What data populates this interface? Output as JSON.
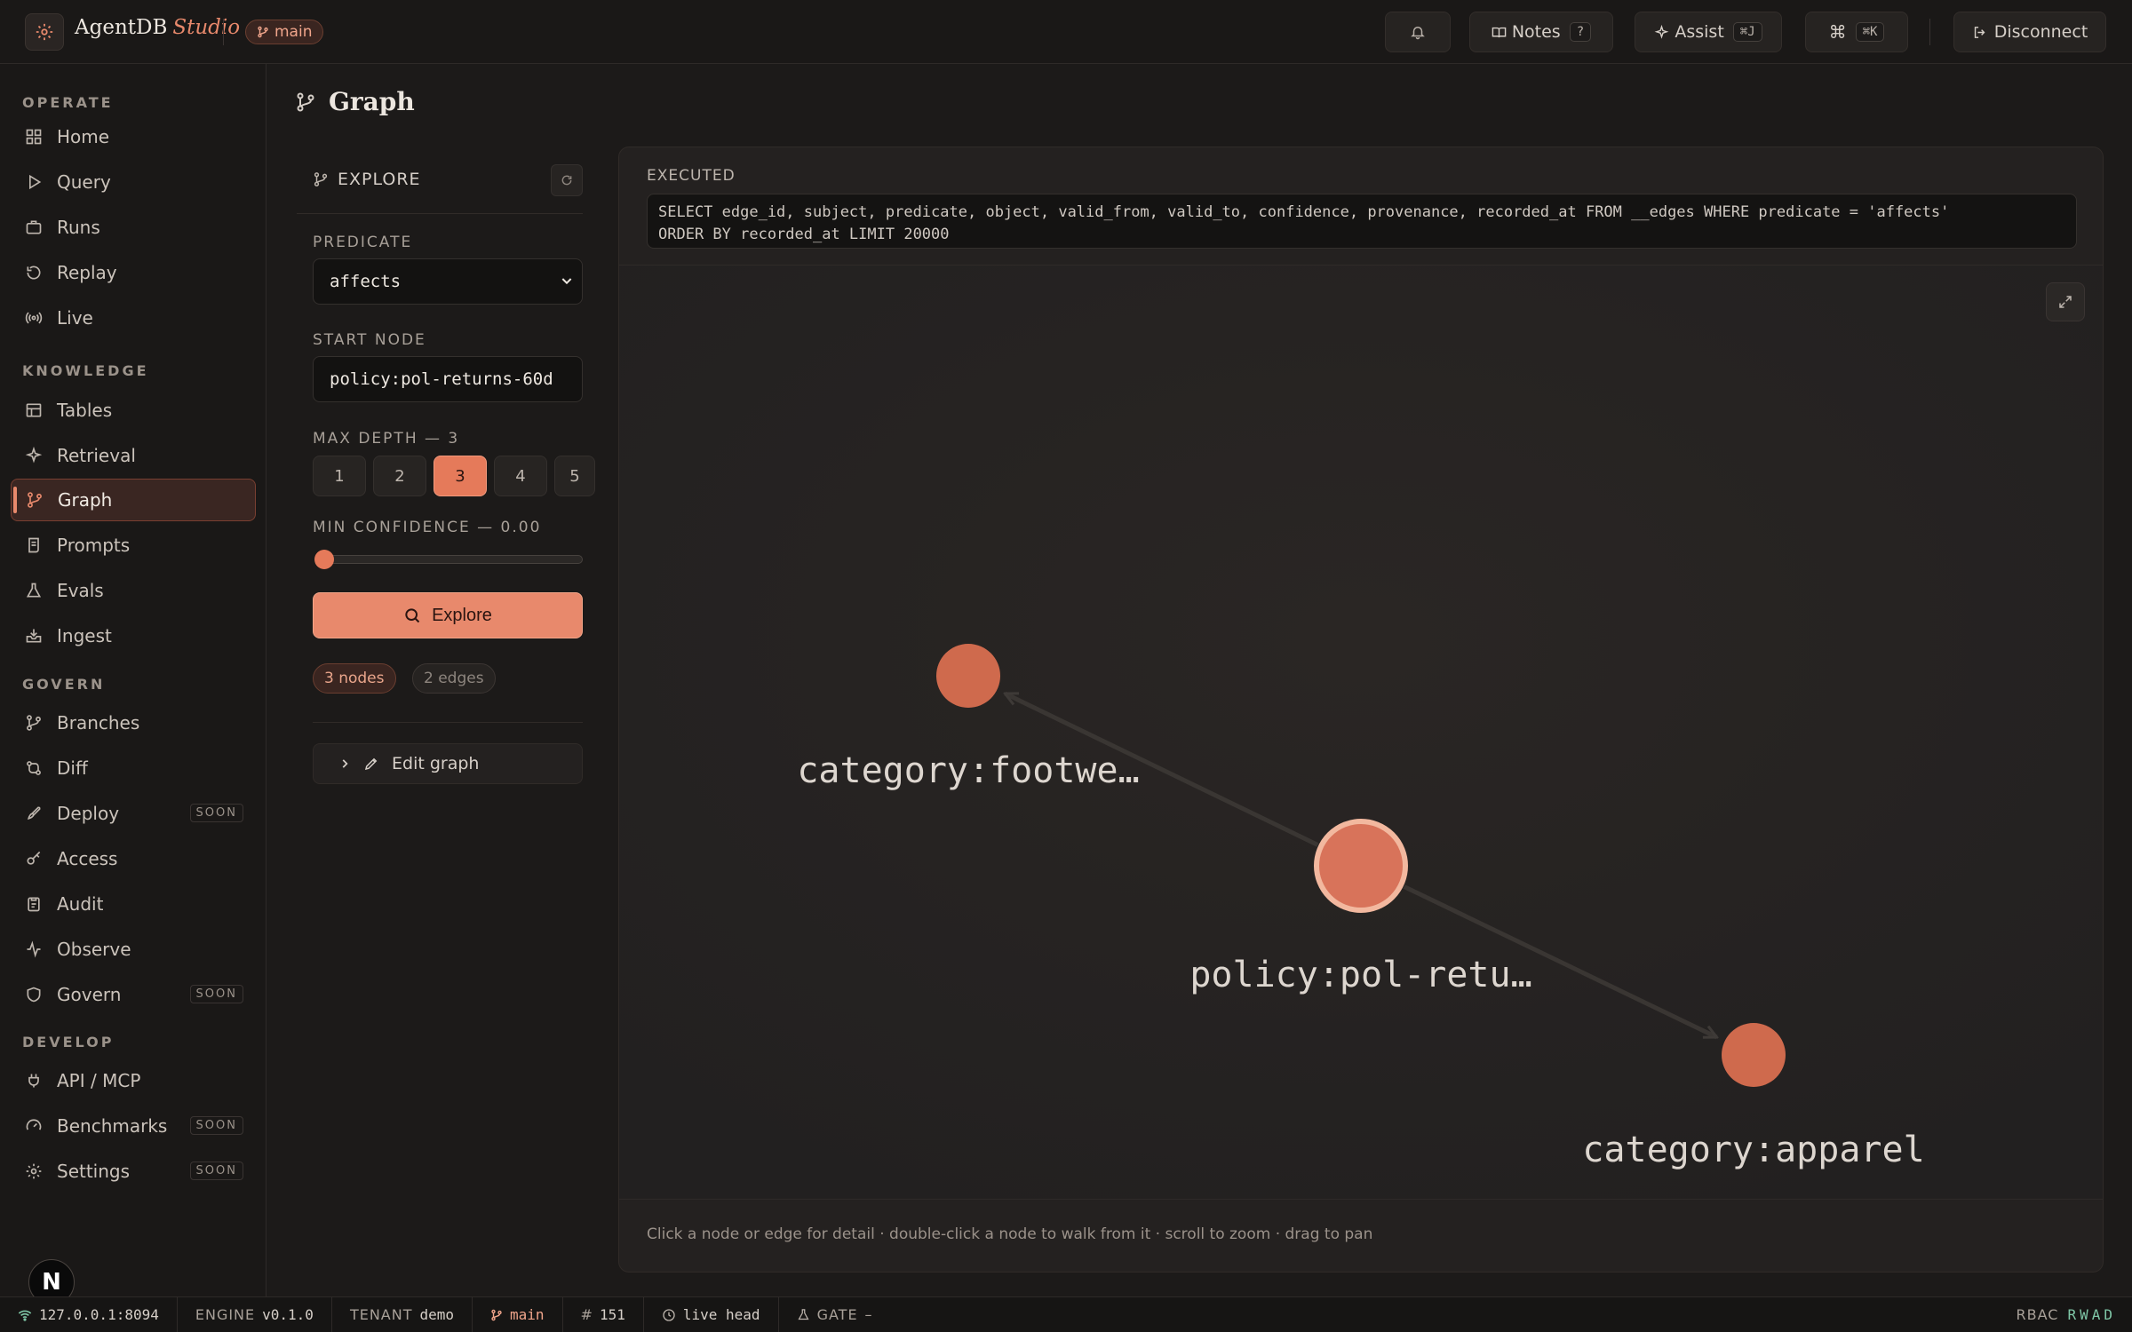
{
  "app": {
    "name": "AgentDB",
    "name_suffix": "Studio",
    "branch": "main"
  },
  "toolbar": {
    "notes_label": "Notes",
    "notes_kbd": "?",
    "assist_label": "Assist",
    "assist_kbd": "⌘J",
    "command_glyph": "⌘",
    "command_kbd": "⌘K",
    "disconnect_label": "Disconnect"
  },
  "sidebar": {
    "sections": [
      {
        "title": "OPERATE",
        "items": [
          {
            "label": "Home",
            "icon": "grid-icon"
          },
          {
            "label": "Query",
            "icon": "play-icon"
          },
          {
            "label": "Runs",
            "icon": "briefcase-icon"
          },
          {
            "label": "Replay",
            "icon": "rotate-icon"
          },
          {
            "label": "Live",
            "icon": "broadcast-icon"
          }
        ]
      },
      {
        "title": "KNOWLEDGE",
        "items": [
          {
            "label": "Tables",
            "icon": "table-icon"
          },
          {
            "label": "Retrieval",
            "icon": "sparkle-icon"
          },
          {
            "label": "Graph",
            "icon": "graph-icon",
            "active": true
          },
          {
            "label": "Prompts",
            "icon": "scroll-icon"
          },
          {
            "label": "Evals",
            "icon": "flask-icon"
          },
          {
            "label": "Ingest",
            "icon": "inbox-icon"
          }
        ]
      },
      {
        "title": "GOVERN",
        "items": [
          {
            "label": "Branches",
            "icon": "git-branch-icon"
          },
          {
            "label": "Diff",
            "icon": "git-compare-icon"
          },
          {
            "label": "Deploy",
            "icon": "rocket-icon",
            "badge": "SOON"
          },
          {
            "label": "Access",
            "icon": "key-icon"
          },
          {
            "label": "Audit",
            "icon": "clipboard-icon"
          },
          {
            "label": "Observe",
            "icon": "activity-icon"
          },
          {
            "label": "Govern",
            "icon": "shield-icon",
            "badge": "SOON"
          }
        ]
      },
      {
        "title": "DEVELOP",
        "items": [
          {
            "label": "API / MCP",
            "icon": "plug-icon"
          },
          {
            "label": "Benchmarks",
            "icon": "gauge-icon",
            "badge": "SOON"
          },
          {
            "label": "Settings",
            "icon": "gear-icon",
            "badge": "SOON"
          }
        ]
      }
    ],
    "avatar_letter": "N"
  },
  "page": {
    "title": "Graph"
  },
  "explore": {
    "title": "EXPLORE",
    "predicate_label": "PREDICATE",
    "predicate_value": "affects",
    "start_node_label": "START NODE",
    "start_node_value": "policy:pol-returns-60d",
    "max_depth_label": "MAX DEPTH — 3",
    "depth_options": [
      "1",
      "2",
      "3",
      "4",
      "5"
    ],
    "max_depth": 3,
    "min_confidence_label": "MIN CONFIDENCE — 0.00",
    "min_confidence": 0.0,
    "explore_button": "Explore",
    "nodes_count": "3 nodes",
    "edges_count": "2 edges",
    "edit_graph_label": "Edit graph"
  },
  "graph": {
    "executed_label": "EXECUTED",
    "executed_sql": "SELECT edge_id, subject, predicate, object, valid_from, valid_to, confidence, provenance, recorded_at FROM __edges WHERE predicate = 'affects'\nORDER BY recorded_at LIMIT 20000",
    "nodes": [
      {
        "id": "category:footwear",
        "label": "category:footwe…",
        "role": "neighbor"
      },
      {
        "id": "policy:pol-returns-60d",
        "label": "policy:pol-retu…",
        "role": "start"
      },
      {
        "id": "category:apparel",
        "label": "category:apparel",
        "role": "neighbor"
      }
    ],
    "edges": [
      {
        "from": "policy:pol-returns-60d",
        "to": "category:footwear"
      },
      {
        "from": "policy:pol-returns-60d",
        "to": "category:apparel"
      }
    ],
    "hint": "Click a node or edge for detail · double-click a node to walk from it · scroll to zoom · drag to pan"
  },
  "status": {
    "host": "127.0.0.1:8094",
    "engine_label": "ENGINE",
    "engine_version": "v0.1.0",
    "tenant_label": "TENANT",
    "tenant_value": "demo",
    "branch": "main",
    "commit_hash": "151",
    "head": "live head",
    "gate_label": "GATE",
    "gate_value": "–",
    "rbac_label": "RBAC",
    "rbac_perms": "RWAD"
  },
  "colors": {
    "accent": "#e8896c",
    "node_fill": "#cf6a4d",
    "background": "#1c1a19",
    "status_ok": "#7fc7a7"
  }
}
